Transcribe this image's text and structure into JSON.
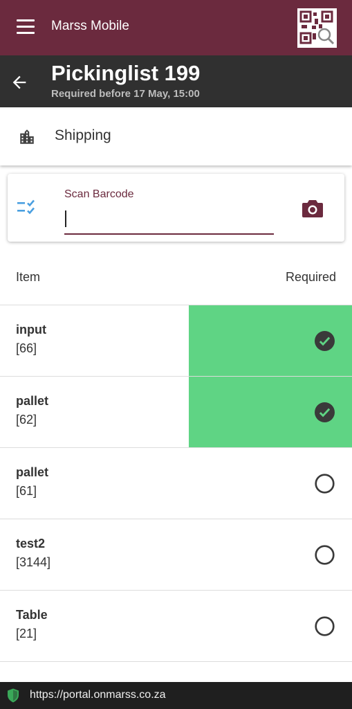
{
  "app": {
    "title": "Marss Mobile",
    "brand_color": "#6b2a3e"
  },
  "header": {
    "title": "Pickinglist 199",
    "subtitle": "Required before 17 May, 15:00"
  },
  "location": {
    "label": "Shipping",
    "icon": "building-icon"
  },
  "scan": {
    "label": "Scan Barcode",
    "value": "",
    "icon": "checklist-icon",
    "camera_icon": "camera-icon"
  },
  "table": {
    "headers": {
      "item": "Item",
      "required": "Required"
    },
    "rows": [
      {
        "name": "input",
        "code": "[66]",
        "done": true
      },
      {
        "name": "pallet",
        "code": "[62]",
        "done": true
      },
      {
        "name": "pallet",
        "code": "[61]",
        "done": false
      },
      {
        "name": "test2",
        "code": "[3144]",
        "done": false
      },
      {
        "name": "Table",
        "code": "[21]",
        "done": false
      }
    ],
    "done_color": "#5fd484"
  },
  "browser": {
    "url": "https://portal.onmarss.co.za"
  }
}
